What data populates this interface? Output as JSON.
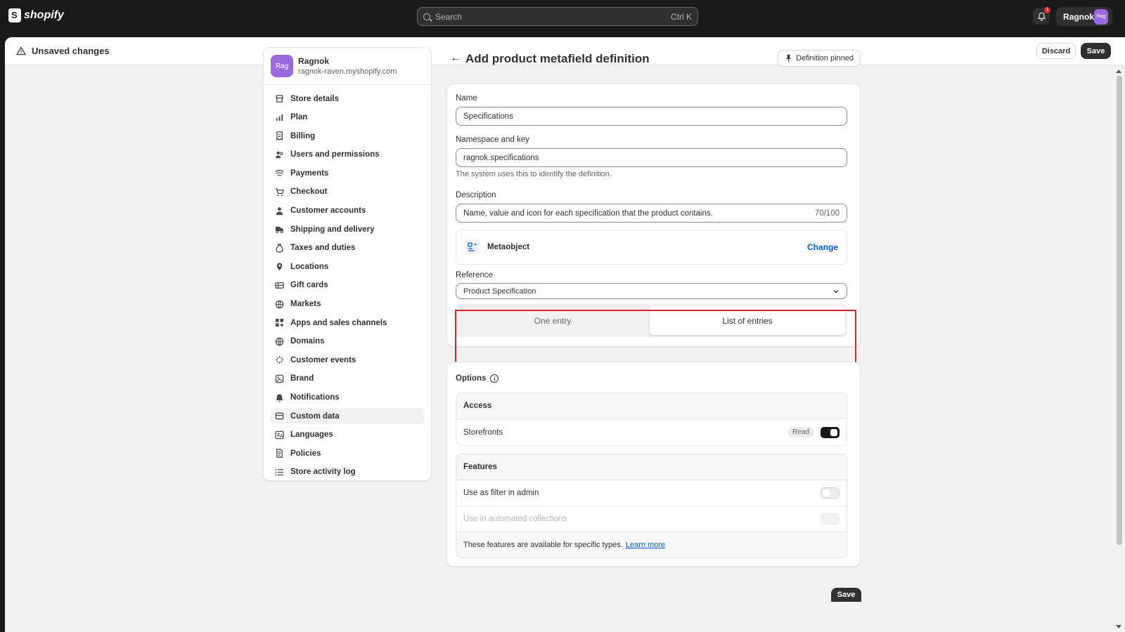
{
  "topbar": {
    "brand": "shopify",
    "search_placeholder": "Search",
    "search_shortcut": "Ctrl K",
    "notification_count": "1",
    "user_name": "Ragnok",
    "user_avatar": "Rag"
  },
  "savebar": {
    "title": "Unsaved changes",
    "discard_label": "Discard",
    "save_label": "Save"
  },
  "store": {
    "avatar": "Rag",
    "name": "Ragnok",
    "domain": "ragnok-raven.myshopify.com"
  },
  "sidebar": {
    "items": [
      {
        "label": "Store details",
        "icon": "store-icon"
      },
      {
        "label": "Plan",
        "icon": "plan-icon"
      },
      {
        "label": "Billing",
        "icon": "billing-icon"
      },
      {
        "label": "Users and permissions",
        "icon": "users-icon"
      },
      {
        "label": "Payments",
        "icon": "payments-icon"
      },
      {
        "label": "Checkout",
        "icon": "cart-icon"
      },
      {
        "label": "Customer accounts",
        "icon": "person-icon"
      },
      {
        "label": "Shipping and delivery",
        "icon": "truck-icon"
      },
      {
        "label": "Taxes and duties",
        "icon": "tax-icon"
      },
      {
        "label": "Locations",
        "icon": "location-icon"
      },
      {
        "label": "Gift cards",
        "icon": "gift-card-icon"
      },
      {
        "label": "Markets",
        "icon": "globe-icon"
      },
      {
        "label": "Apps and sales channels",
        "icon": "apps-icon"
      },
      {
        "label": "Domains",
        "icon": "globe-icon"
      },
      {
        "label": "Customer events",
        "icon": "sparkle-icon"
      },
      {
        "label": "Brand",
        "icon": "brand-icon"
      },
      {
        "label": "Notifications",
        "icon": "bell-icon"
      },
      {
        "label": "Custom data",
        "icon": "database-icon",
        "active": true
      },
      {
        "label": "Languages",
        "icon": "language-icon"
      },
      {
        "label": "Policies",
        "icon": "policy-icon"
      },
      {
        "label": "Store activity log",
        "icon": "list-icon"
      }
    ]
  },
  "page": {
    "title": "Add product metafield definition",
    "pin_label": "Definition pinned"
  },
  "form": {
    "name_label": "Name",
    "name_value": "Specifications",
    "namespace_label": "Namespace and key",
    "namespace_value": "ragnok.specifications",
    "namespace_help": "The system uses this to identify the definition.",
    "description_label": "Description",
    "description_value": "Name, value and icon for each specification that the product contains.",
    "description_count": "70/100",
    "type_name": "Metaobject",
    "type_change": "Change",
    "reference_label": "Reference",
    "reference_value": "Product Specification",
    "seg_one": "One entry",
    "seg_list": "List of entries"
  },
  "options": {
    "title": "Options",
    "access_title": "Access",
    "storefronts_label": "Storefronts",
    "storefronts_badge": "Read",
    "features_title": "Features",
    "filter_label": "Use as filter in admin",
    "collections_label": "Use in automated collections",
    "note": "These features are available for specific types.",
    "learn_more": "Learn more"
  },
  "footer": {
    "save_label": "Save"
  },
  "colors": {
    "highlight": "#d9202c",
    "link": "#005bd3",
    "avatar": "#9c6ade"
  }
}
